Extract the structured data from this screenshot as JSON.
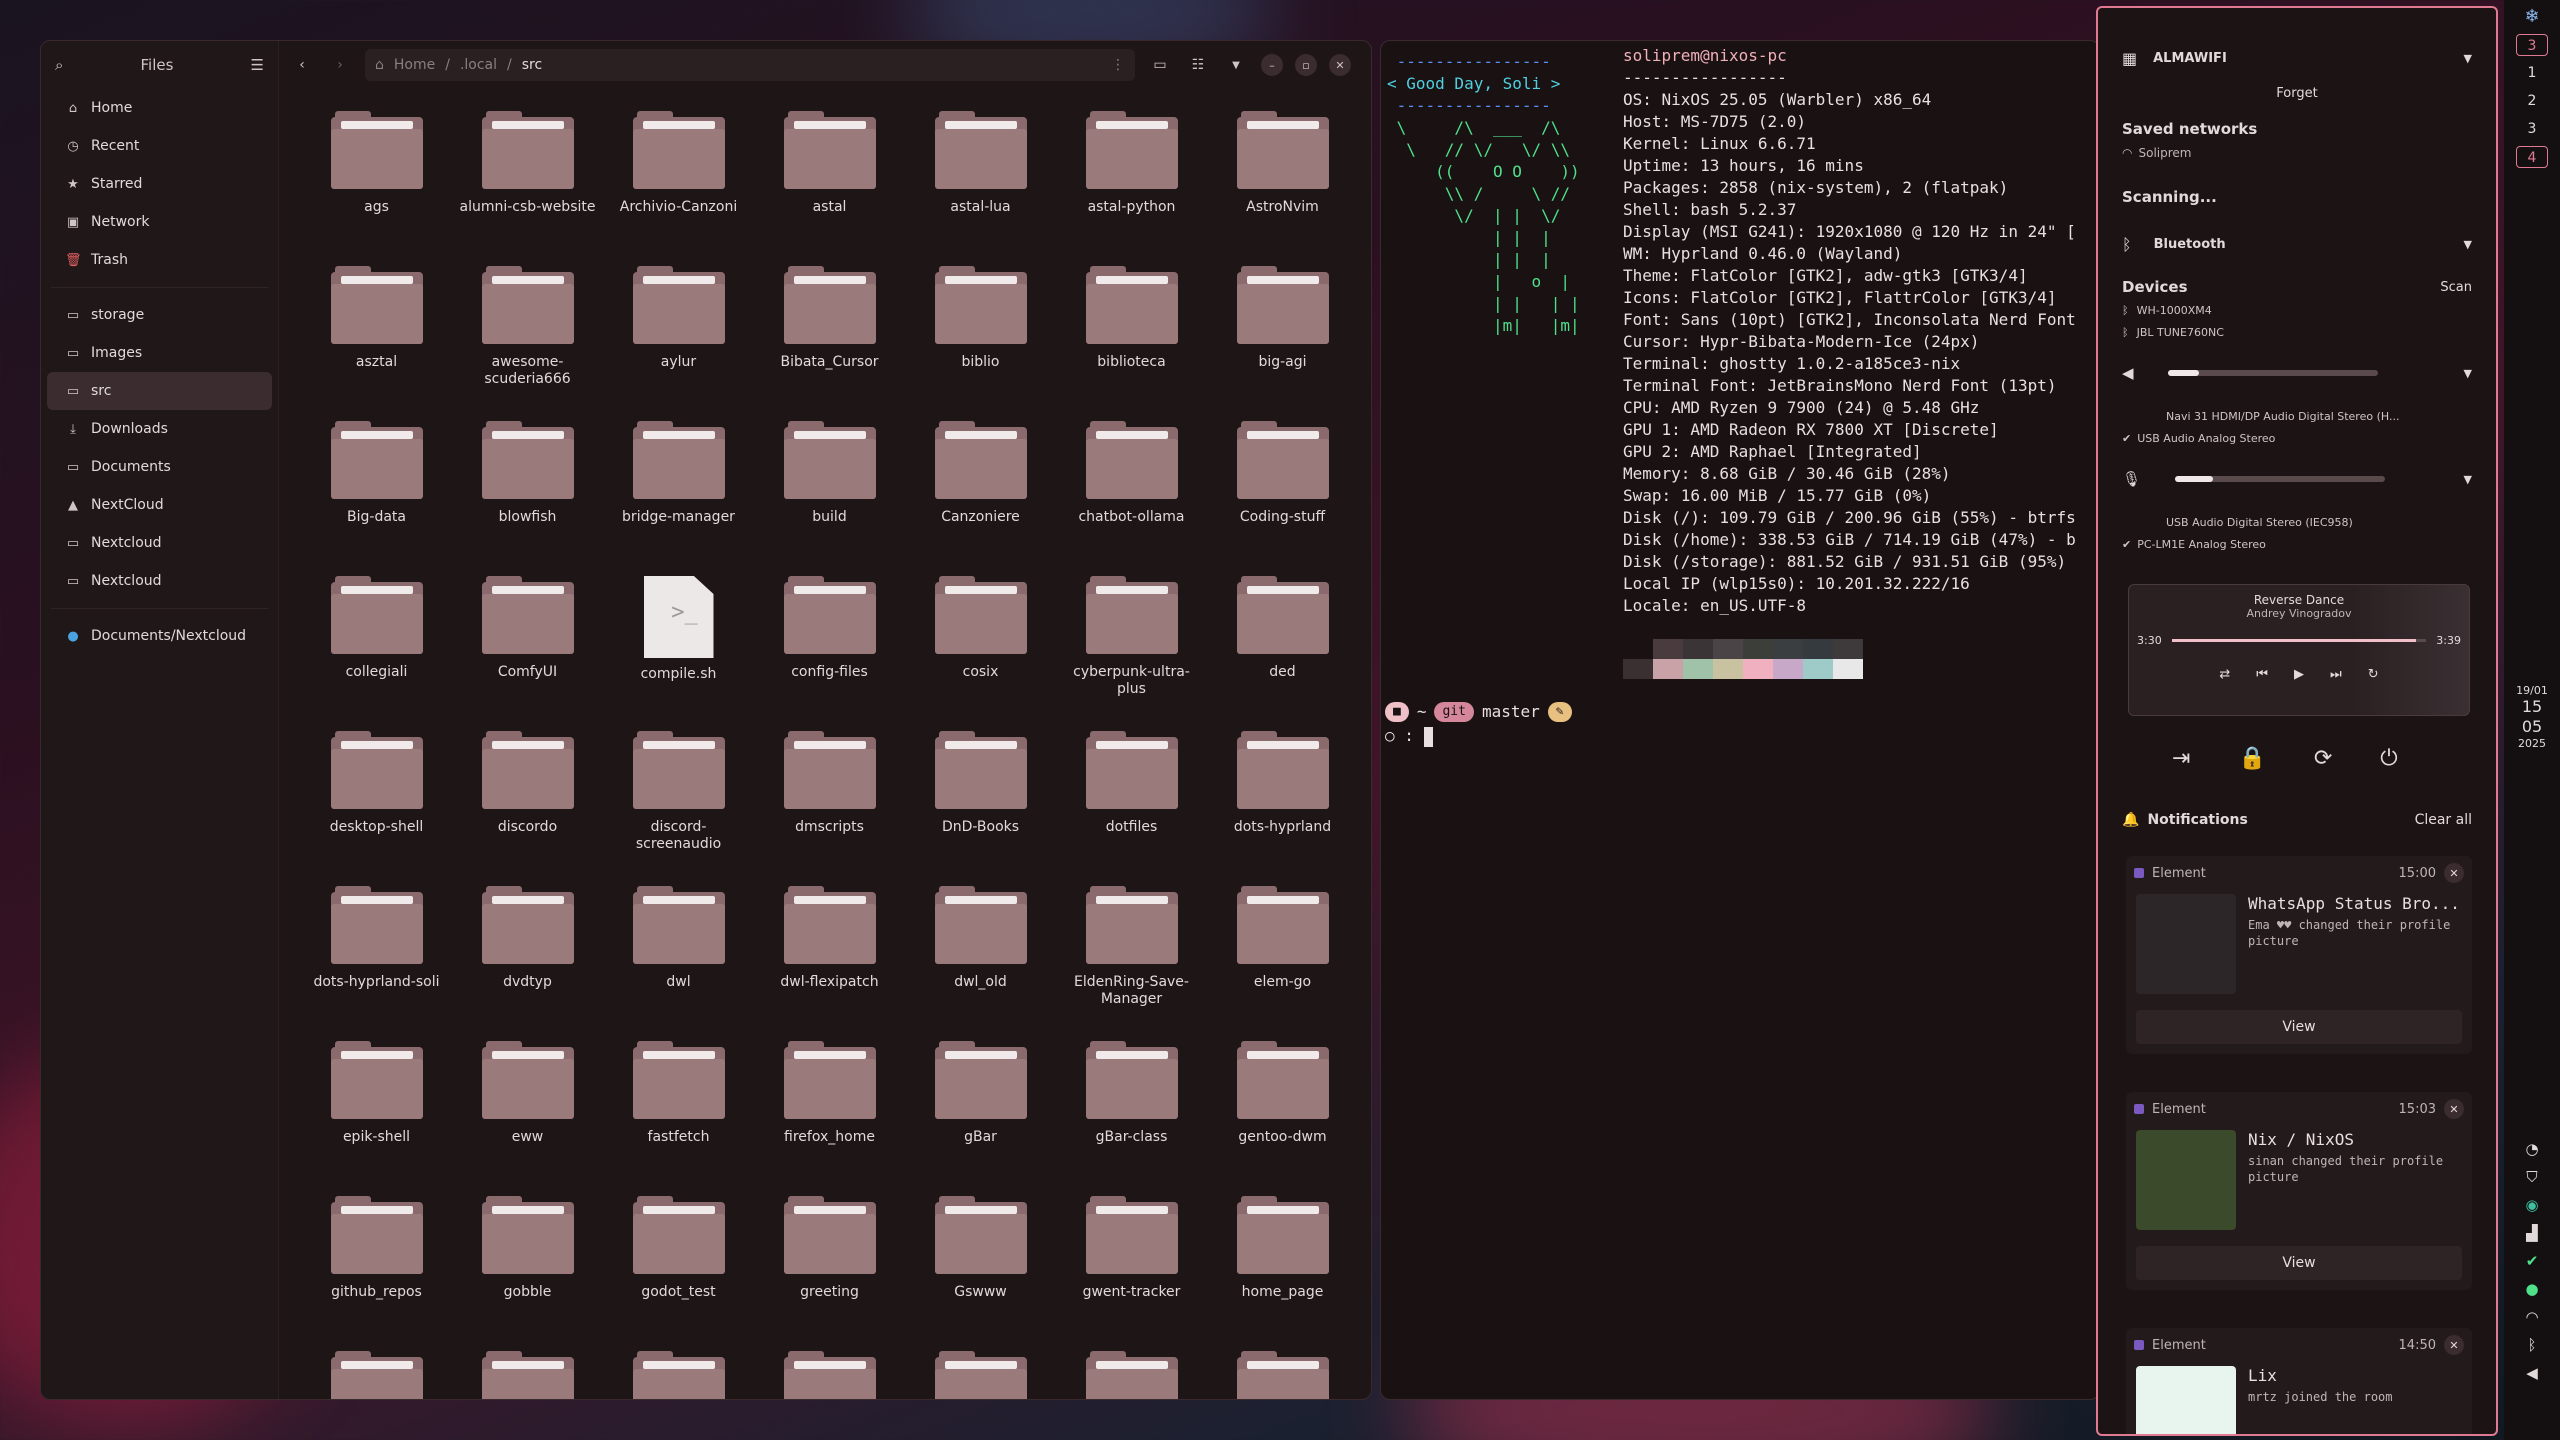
{
  "files": {
    "title": "Files",
    "sidebar": [
      {
        "icon": "home-icon",
        "label": "Home"
      },
      {
        "icon": "clock-icon",
        "label": "Recent"
      },
      {
        "icon": "star-icon",
        "label": "Starred"
      },
      {
        "icon": "network-icon",
        "label": "Network"
      },
      {
        "icon": "trash-icon",
        "label": "Trash"
      },
      {
        "icon": "folder-icon",
        "label": "storage"
      },
      {
        "icon": "folder-icon",
        "label": "Images"
      },
      {
        "icon": "folder-icon",
        "label": "src"
      },
      {
        "icon": "download-icon",
        "label": "Downloads"
      },
      {
        "icon": "folder-icon",
        "label": "Documents"
      },
      {
        "icon": "nextcloud-icon",
        "label": "NextCloud"
      },
      {
        "icon": "folder-icon",
        "label": "Nextcloud"
      },
      {
        "icon": "folder-icon",
        "label": "Nextcloud"
      },
      {
        "icon": "network-drive-icon",
        "label": "Documents/Nextcloud"
      }
    ],
    "active_sidebar": "src",
    "path": [
      "Home",
      "/",
      ".local",
      "/",
      "src"
    ],
    "items": [
      "ags",
      "alumni-csb-website",
      "Archivio-Canzoni",
      "astal",
      "astal-lua",
      "astal-python",
      "AstroNvim",
      "asztal",
      "awesome-scuderia666",
      "aylur",
      "Bibata_Cursor",
      "biblio",
      "biblioteca",
      "big-agi",
      "Big-data",
      "blowfish",
      "bridge-manager",
      "build",
      "Canzoniere",
      "chatbot-ollama",
      "Coding-stuff",
      "collegiali",
      "ComfyUI",
      "compile.sh",
      "config-files",
      "cosix",
      "cyberpunk-ultra-plus",
      "ded",
      "desktop-shell",
      "discordo",
      "discord-screenaudio",
      "dmscripts",
      "DnD-Books",
      "dotfiles",
      "dots-hyprland",
      "dots-hyprland-soli",
      "dvdtyp",
      "dwl",
      "dwl-flexipatch",
      "dwl_old",
      "EldenRing-Save-Manager",
      "elem-go",
      "epik-shell",
      "eww",
      "fastfetch",
      "firefox_home",
      "gBar",
      "gBar-class",
      "gentoo-dwm",
      "github_repos",
      "gobble",
      "godot_test",
      "greeting",
      "Gswww",
      "gwent-tracker",
      "home_page",
      "",
      "",
      "",
      "",
      "",
      "",
      ""
    ],
    "file_items": [
      "compile.sh"
    ]
  },
  "terminal": {
    "logo_greeting": "< Good Day, Soli >",
    "user_host": "soliprem@nixos-pc",
    "separator": "-----------------",
    "info": [
      "OS: NixOS 25.05 (Warbler) x86_64",
      "Host: MS-7D75 (2.0)",
      "Kernel: Linux 6.6.71",
      "Uptime: 13 hours, 16 mins",
      "Packages: 2858 (nix-system), 2 (flatpak)",
      "Shell: bash 5.2.37",
      "Display (MSI G241): 1920x1080 @ 120 Hz in 24\" [",
      "WM: Hyprland 0.46.0 (Wayland)",
      "Theme: FlatColor [GTK2], adw-gtk3 [GTK3/4]",
      "Icons: FlatColor [GTK2], FlattrColor [GTK3/4]",
      "Font: Sans (10pt) [GTK2], Inconsolata Nerd Font",
      "Cursor: Hypr-Bibata-Modern-Ice (24px)",
      "Terminal: ghostty 1.0.2-a185ce3-nix",
      "Terminal Font: JetBrainsMono Nerd Font (13pt)",
      "CPU: AMD Ryzen 9 7900 (24) @ 5.48 GHz",
      "GPU 1: AMD Radeon RX 7800 XT [Discrete]",
      "GPU 2: AMD Raphael [Integrated]",
      "Memory: 8.68 GiB / 30.46 GiB (28%)",
      "Swap: 16.00 MiB / 15.77 GiB (0%)",
      "Disk (/): 109.79 GiB / 200.96 GiB (55%) - btrfs",
      "Disk (/home): 338.53 GiB / 714.19 GiB (47%) - b",
      "Disk (/storage): 881.52 GiB / 931.51 GiB (95%)",
      "Local IP (wlp15s0): 10.201.32.222/16",
      "Locale: en_US.UTF-8"
    ],
    "swatch_colors": [
      "#1a1113",
      "#4a3c3e",
      "#3a3436",
      "#4a4446",
      "#3c3e3a",
      "#3a3e40",
      "#343a3e",
      "#3e3a3c",
      "#3a3032",
      "#c9a2a8",
      "#9fc2a8",
      "#c8c2a0",
      "#f0b0c0",
      "#c8a8c8",
      "#9ecac8",
      "#e8e8e8"
    ],
    "prompt_dir": "~",
    "prompt_git": "git",
    "prompt_branch": "master",
    "prompt_status": "✎",
    "prompt_line2": ":"
  },
  "panel": {
    "wifi_name": "ALMAWIFI",
    "forget": "Forget",
    "saved_networks": "Saved networks",
    "saved_net": "Soliprem",
    "scanning": "Scanning...",
    "bluetooth": "Bluetooth",
    "devices": "Devices",
    "scan": "Scan",
    "device1": "WH-1000XM4",
    "device2": "JBL TUNE760NC",
    "volume_level": 0.15,
    "audio_out1": "Navi 31 HDMI/DP Audio Digital Stereo (H...",
    "audio_out2": "USB Audio Analog Stereo",
    "mic_level": 0.18,
    "audio_in1": "USB Audio Digital Stereo (IEC958)",
    "audio_in2": "PC-LM1E Analog Stereo",
    "media": {
      "title": "Reverse Dance",
      "artist": "Andrey Vinogradov",
      "pos": "3:30",
      "len": "3:39",
      "progress": 0.96
    },
    "notifications_label": "Notifications",
    "clear_all": "Clear all",
    "notifications": [
      {
        "app": "Element",
        "time": "15:00",
        "title": "WhatsApp Status Bro...",
        "text": "Ema ♥♥ changed their profile picture",
        "button": "View",
        "img": "#2c2628"
      },
      {
        "app": "Element",
        "time": "15:03",
        "title": "Nix / NixOS",
        "text": "sinan changed their profile picture",
        "button": "View",
        "img": "#3a4a2a"
      },
      {
        "app": "Element",
        "time": "14:50",
        "title": "Lix",
        "text": "mrtz joined the room",
        "button": "",
        "img": "#e8f4ee"
      }
    ]
  },
  "bar": {
    "workspaces": [
      "3",
      "1",
      "2",
      "3",
      "4"
    ],
    "date_line": "19/01",
    "hour": "15",
    "minute": "05",
    "year": "2025"
  }
}
